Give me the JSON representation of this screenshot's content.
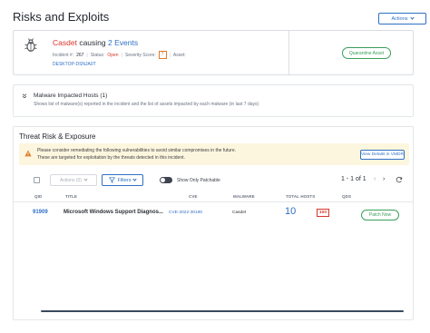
{
  "page": {
    "title": "Risks and Exploits",
    "actions_label": "Actions"
  },
  "incident": {
    "icon": "bug-icon",
    "name": "Casdet",
    "causing_text": "causing",
    "events_text": "2 Events",
    "incident_label": "Incident #:",
    "incident_number": "267",
    "status_label": "Status:",
    "status_value": "Open",
    "severity_label": "Severity Score:",
    "severity_value": "7",
    "asset_label": "Asset:",
    "asset_value": "DESKTOP-DSNJA0T",
    "quarantine_label": "Quarantine Asset"
  },
  "malware_section": {
    "title": "Malware Impacted Hosts (1)",
    "description": "Shows list of malware(s) reported in the incident and the list of assets impacted by each malware (in last 7 days)"
  },
  "threat_section": {
    "title": "Threat Risk & Exposure",
    "banner_line1": "Please consider remediating the following vulnerabilities to avoid similar compromises in the future.",
    "banner_line2": "These are targeted for exploitation by the threats detected in this incident.",
    "vmdr_button": "View Details in VMDR",
    "toolbar": {
      "actions_label": "Actions (0)",
      "filters_label": "Filters",
      "toggle_label": "Show Only Patchable",
      "pager_text": "1 - 1 of 1",
      "prev": "‹",
      "next": "›"
    },
    "columns": {
      "qid": "QID",
      "title": "TITLE",
      "cve": "CVE",
      "malware": "MALWARE",
      "total_hosts": "TOTAL HOSTS",
      "qds": "QDS"
    },
    "rows": [
      {
        "qid": "91909",
        "title": "Microsoft Windows Support Diagnos...",
        "cve": "CVE-2022-30190",
        "malware": "Casdet",
        "total_hosts": "10",
        "qds": "100",
        "action": "Patch Now"
      }
    ]
  },
  "colors": {
    "accent": "#2f6fc6",
    "danger": "#d8352a",
    "success": "#3a9e5b",
    "warning_bg": "#fdf6de",
    "severity": "#e07b2c"
  }
}
